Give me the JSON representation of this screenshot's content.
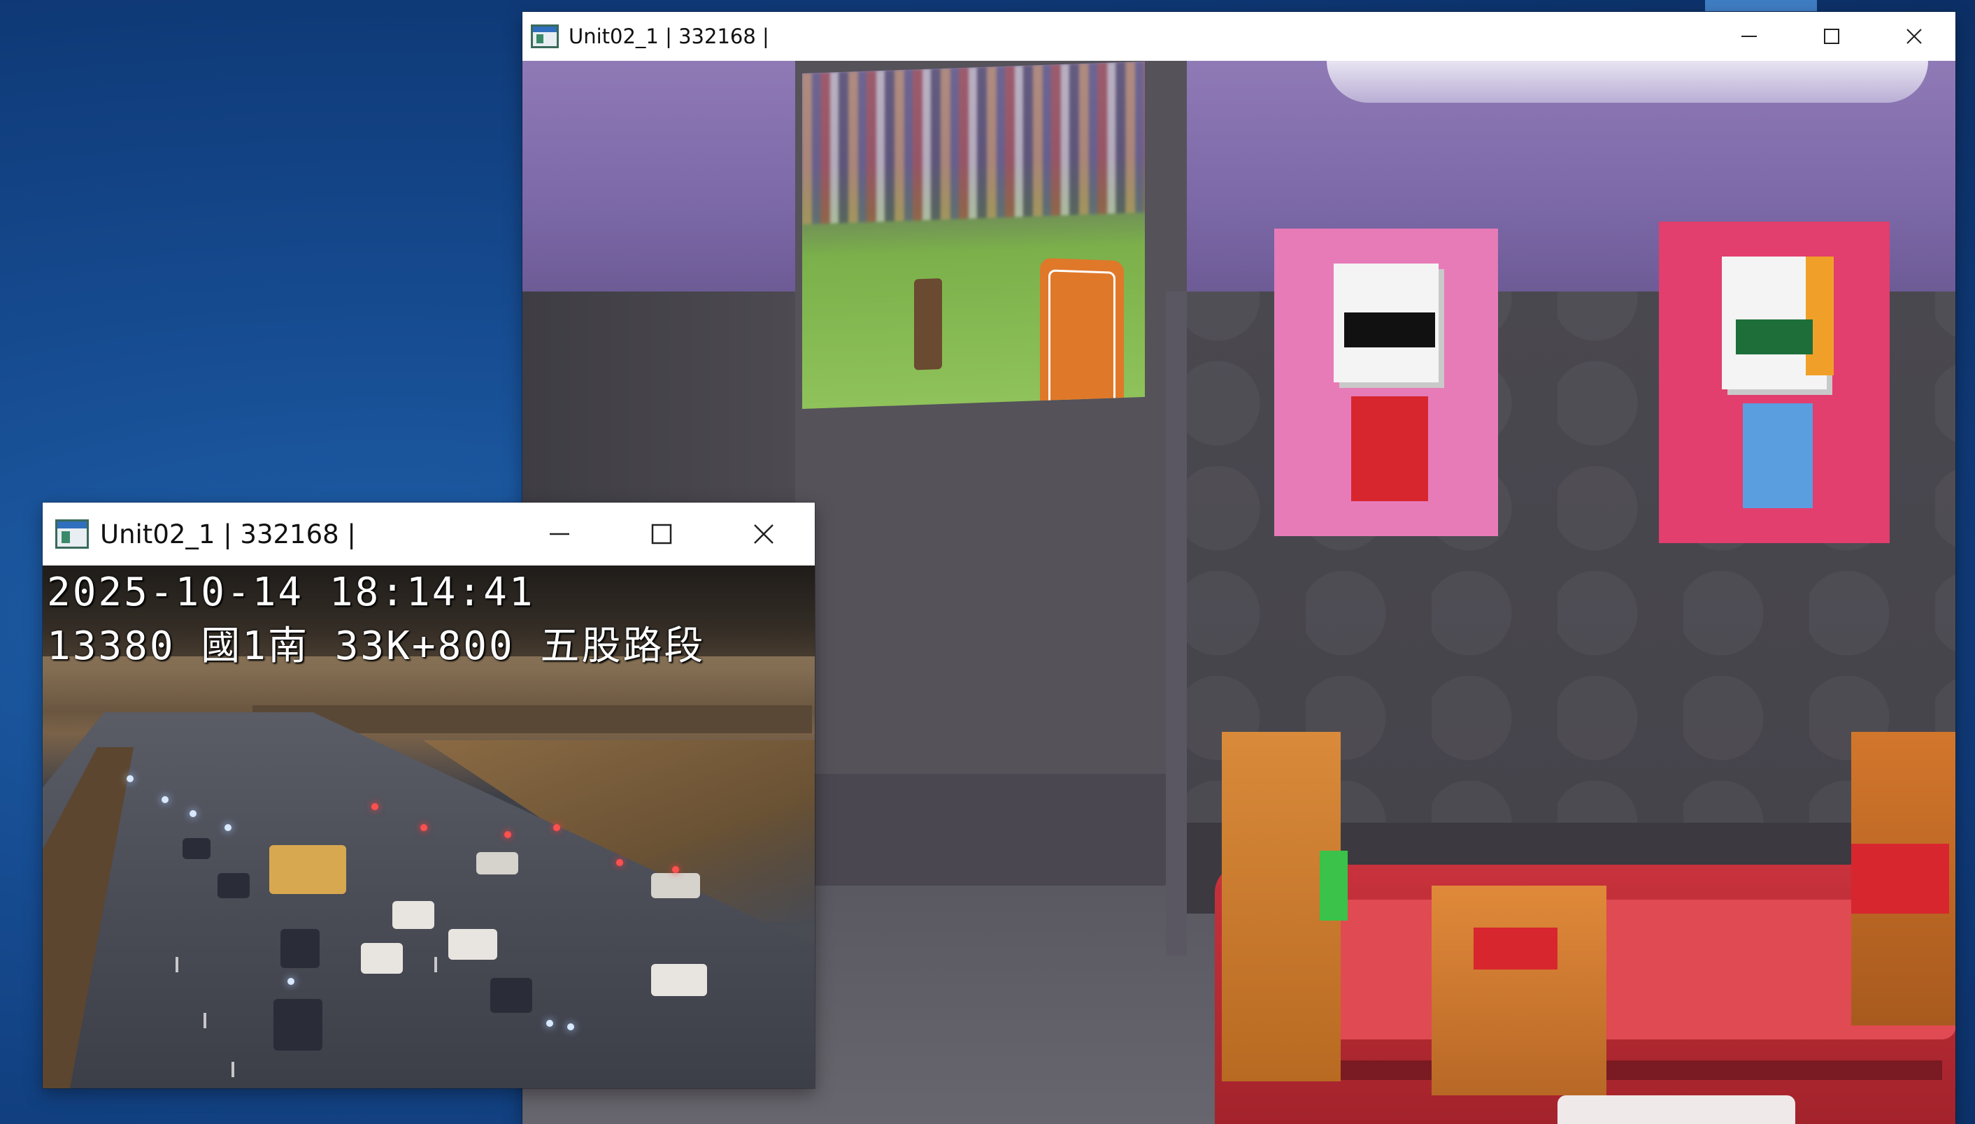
{
  "desktop": {
    "accent": "#164b90"
  },
  "windows": [
    {
      "id": "main-view",
      "title": "Unit02_1 | 332168 |",
      "icon": "app-window-icon",
      "controls": {
        "minimize": "minimize-icon",
        "maximize": "maximize-icon",
        "close": "close-icon"
      }
    },
    {
      "id": "camera-feed",
      "title": "Unit02_1 | 332168 |",
      "icon": "app-window-icon",
      "controls": {
        "minimize": "minimize-icon",
        "maximize": "maximize-icon",
        "close": "close-icon"
      },
      "overlay": {
        "timestamp": "2025-10-14 18:14:41",
        "location": "13380 國1南 33K+800 五股路段"
      }
    }
  ]
}
